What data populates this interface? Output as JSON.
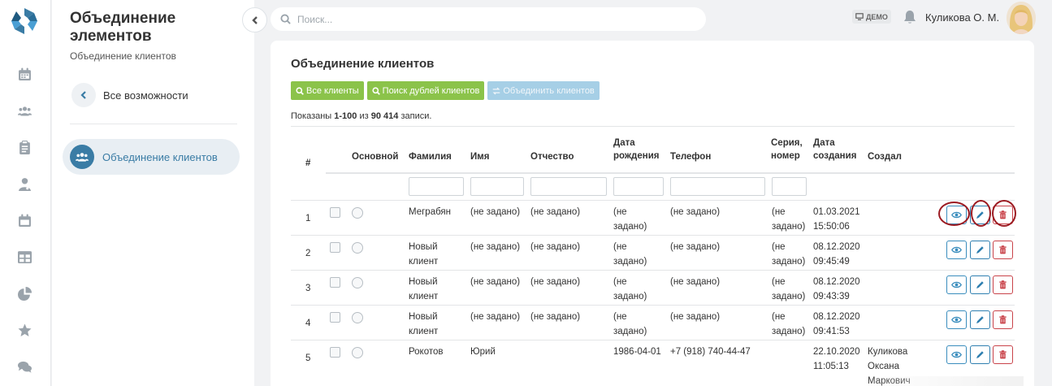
{
  "sidebar": {
    "title": "Объединение элементов",
    "subtitle": "Объединение клиентов",
    "back_label": "Все возможности",
    "active_label": "Объединение клиентов"
  },
  "rail": {
    "icons": [
      "calendar-icon",
      "users-icon",
      "clipboard-icon",
      "user-doctor-icon",
      "calendar-alt-icon",
      "table-icon",
      "pie-chart-icon",
      "star-icon",
      "comments-icon"
    ]
  },
  "topbar": {
    "search_placeholder": "Поиск...",
    "demo_badge": "ДЕМО",
    "user_name": "Куликова О. М."
  },
  "main": {
    "title": "Объединение клиентов",
    "buttons": {
      "all_clients": "Все клиенты",
      "find_duplicates": "Поиск дублей клиентов",
      "merge_clients": "Объединить клиентов"
    },
    "summary": {
      "prefix": "Показаны ",
      "range": "1-100",
      "middle": " из ",
      "total": "90 414",
      "suffix": " записи."
    },
    "columns": {
      "num": "#",
      "main": "Основной",
      "surname": "Фамилия",
      "name": "Имя",
      "patronymic": "Отчество",
      "birth_1": "Дата",
      "birth_2": "рождения",
      "phone": "Телефон",
      "series_1": "Серия,",
      "series_2": "номер",
      "created_1": "Дата",
      "created_2": "создания",
      "creator": "Создал"
    },
    "rows": [
      {
        "num": "1",
        "surname_1": "Меграбян",
        "surname_2": "",
        "name": "(не задано)",
        "patronymic": "(не задано)",
        "birth_1": "(не",
        "birth_2": "задано)",
        "phone": "(не задано)",
        "series_1": "(не",
        "series_2": "задано)",
        "created_1": "01.03.2021",
        "created_2": "15:50:06",
        "creator_1": "",
        "creator_2": "",
        "creator_3": ""
      },
      {
        "num": "2",
        "surname_1": "Новый",
        "surname_2": "клиент",
        "name": "(не задано)",
        "patronymic": "(не задано)",
        "birth_1": "(не",
        "birth_2": "задано)",
        "phone": "(не задано)",
        "series_1": "(не",
        "series_2": "задано)",
        "created_1": "08.12.2020",
        "created_2": "09:45:49",
        "creator_1": "",
        "creator_2": "",
        "creator_3": ""
      },
      {
        "num": "3",
        "surname_1": "Новый",
        "surname_2": "клиент",
        "name": "(не задано)",
        "patronymic": "(не задано)",
        "birth_1": "(не",
        "birth_2": "задано)",
        "phone": "(не задано)",
        "series_1": "(не",
        "series_2": "задано)",
        "created_1": "08.12.2020",
        "created_2": "09:43:39",
        "creator_1": "",
        "creator_2": "",
        "creator_3": ""
      },
      {
        "num": "4",
        "surname_1": "Новый",
        "surname_2": "клиент",
        "name": "(не задано)",
        "patronymic": "(не задано)",
        "birth_1": "(не",
        "birth_2": "задано)",
        "phone": "(не задано)",
        "series_1": "(не",
        "series_2": "задано)",
        "created_1": "08.12.2020",
        "created_2": "09:41:53",
        "creator_1": "",
        "creator_2": "",
        "creator_3": ""
      },
      {
        "num": "5",
        "surname_1": "Рокотов",
        "surname_2": "",
        "name": "Юрий",
        "patronymic": "",
        "birth_1": "1986-04-01",
        "birth_2": "",
        "phone": "+7 (918) 740-44-47",
        "series_1": "",
        "series_2": "",
        "created_1": "22.10.2020",
        "created_2": "11:05:13",
        "creator_1": "Куликова",
        "creator_2": "Оксана",
        "creator_3": "Маркович"
      }
    ],
    "highlight_color": "#9c1b22",
    "accent_color": "#3a7ca5",
    "green_color": "#8bc34a"
  }
}
